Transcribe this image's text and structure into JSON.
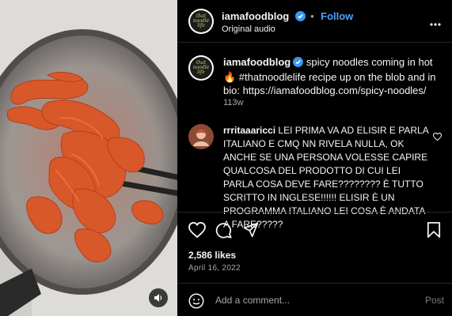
{
  "post": {
    "username": "iamafoodblog",
    "follow_label": "Follow",
    "separator": "•",
    "audio_label": "Original audio",
    "avatar_text": [
      "that",
      "noodle",
      "life"
    ]
  },
  "caption": {
    "username": "iamafoodblog",
    "text": "spicy noodles coming in hot 🔥 #thatnoodlelife recipe up on the blob and in bio: https://iamafoodblog.com/spicy-noodles/",
    "time": "113w"
  },
  "comment": {
    "username": "rrritaaaricci",
    "text": "LEI PRIMA VA AD ELISIR E PARLA ITALIANO E CMQ NN RIVELA NULLA, OK ANCHE SE UNA PERSONA VOLESSE CAPIRE QUALCOSA DEL PRODOTTO DI CUI LEI PARLA COSA DEVE FARE???????? È TUTTO SCRITTO IN INGLESE!!!!!! ELISIR È UN PROGRAMMA ITALIANO LEI COSA È ANDATA A FARE?????"
  },
  "stats": {
    "likes": "2,586 likes",
    "date": "April 16, 2022"
  },
  "add_comment": {
    "placeholder": "Add a comment...",
    "post_label": "Post"
  },
  "icons": {
    "verified": "verified-badge-icon",
    "more": "more-options-icon",
    "like": "heart-icon",
    "comment": "comment-bubble-icon",
    "share": "paper-plane-icon",
    "save": "bookmark-icon",
    "emoji": "emoji-smiley-icon",
    "mute": "speaker-icon"
  },
  "colors": {
    "background": "#000000",
    "accent": "#4aa0ff",
    "verified": "#3897f0",
    "muted_text": "#a8a8a8",
    "noodle": "#d9572a"
  }
}
